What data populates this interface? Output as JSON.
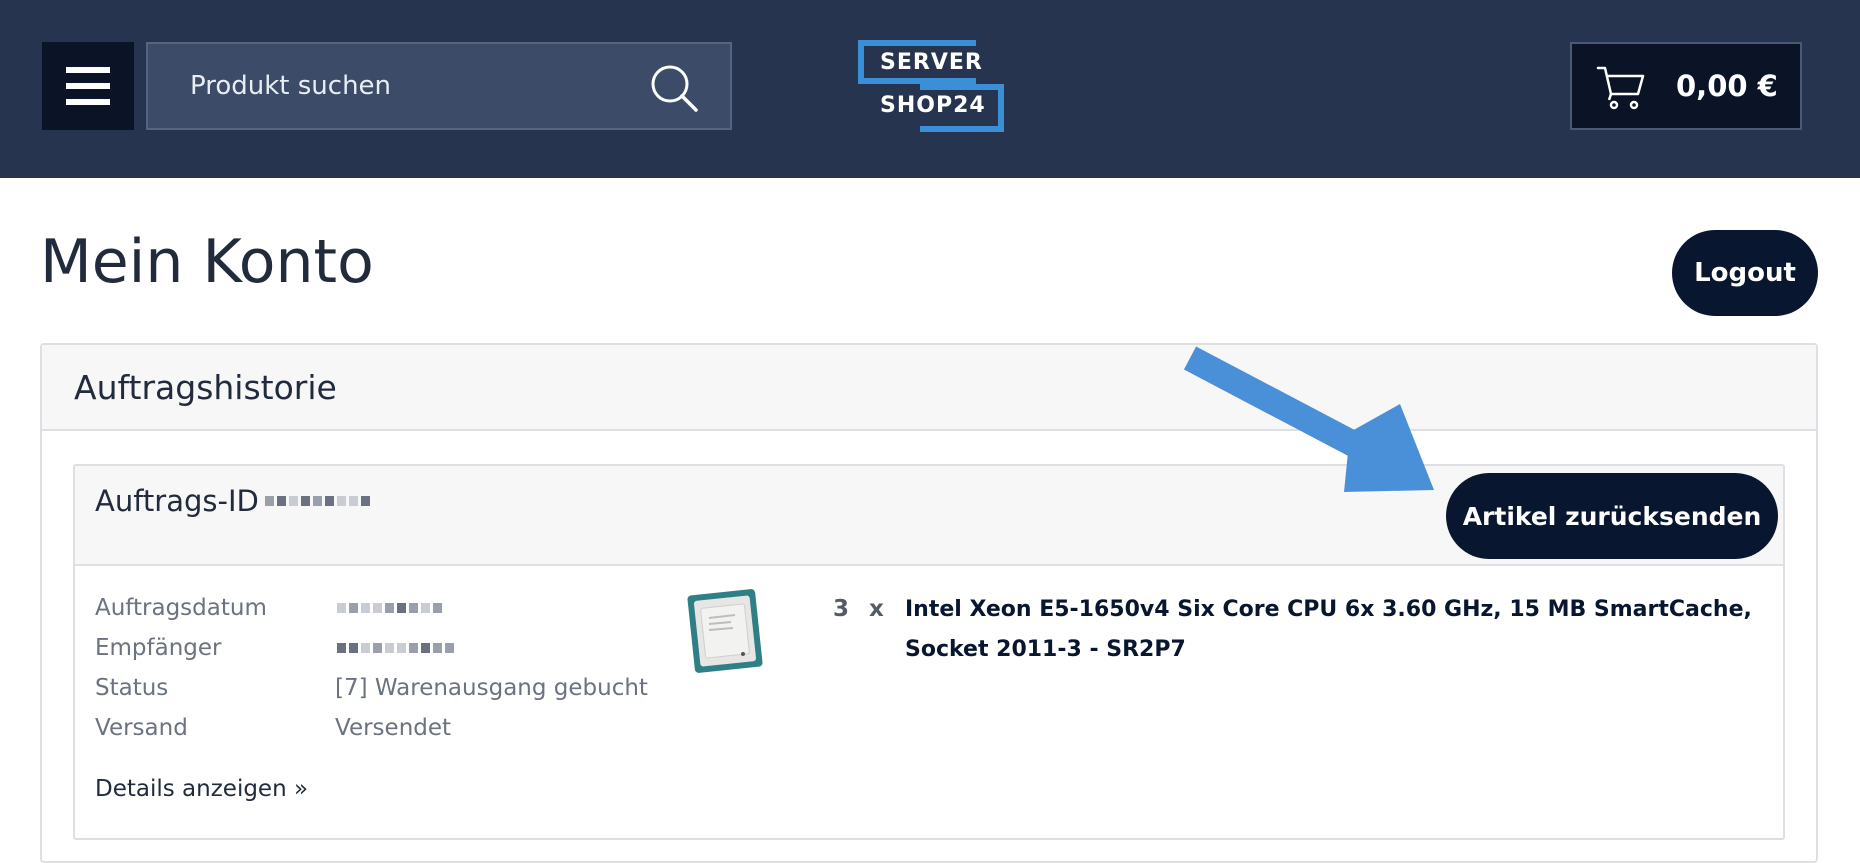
{
  "header": {
    "search": {
      "placeholder": "Produkt suchen",
      "value": ""
    },
    "logo": {
      "line1": "SERVER",
      "line2": "SHOP24"
    },
    "cart": {
      "total": "0,00 €"
    }
  },
  "page": {
    "title": "Mein Konto",
    "logout_label": "Logout"
  },
  "order_history": {
    "title": "Auftragshistorie",
    "order": {
      "id_label": "Auftrags-ID",
      "return_button_label": "Artikel zurücksenden",
      "details": [
        {
          "label": "Auftragsdatum",
          "value": ""
        },
        {
          "label": "Empfänger",
          "value": ""
        },
        {
          "label": "Status",
          "value": "[7] Warenausgang gebucht"
        },
        {
          "label": "Versand",
          "value": "Versendet"
        }
      ],
      "details_link": "Details anzeigen »",
      "item": {
        "quantity": "3",
        "times": "x",
        "name": "Intel Xeon E5-1650v4 Six Core CPU 6x 3.60 GHz, 15 MB SmartCache, Socket 2011-3 - SR2P7"
      }
    }
  },
  "colors": {
    "header_bg": "#26344f",
    "button_dark": "#081630",
    "logo_accent": "#3b8fd6",
    "arrow": "#4a90d9"
  },
  "icons": {
    "menu": "hamburger-icon",
    "search": "search-icon",
    "cart": "cart-icon"
  }
}
